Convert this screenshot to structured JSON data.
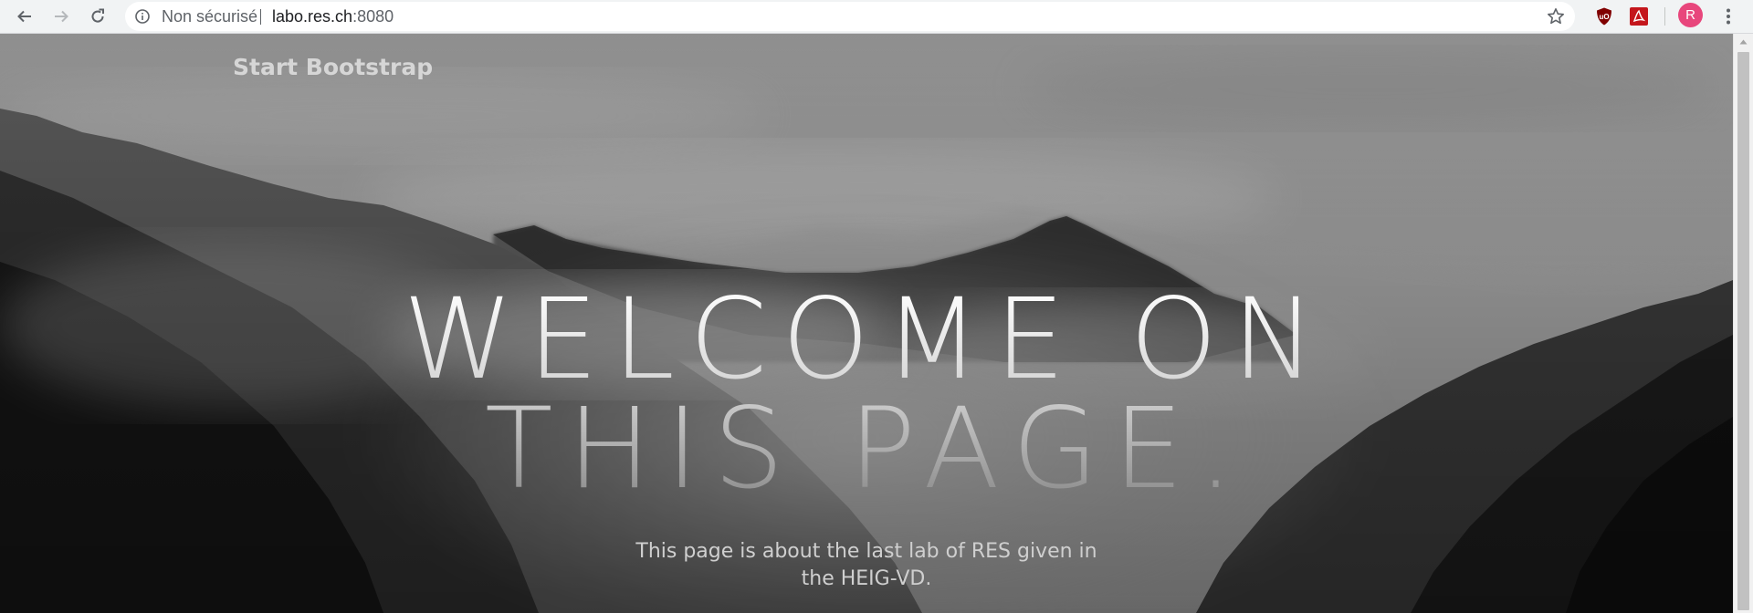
{
  "browser": {
    "omnibox": {
      "security_label": "Non sécurisé",
      "url_host": "labo.res.ch",
      "url_port": ":8080"
    },
    "avatar_initial": "R",
    "icons": {
      "back": "arrow-left-icon",
      "forward": "arrow-right-icon",
      "reload": "reload-icon",
      "info": "info-circle-icon",
      "bookmark": "star-outline-icon",
      "ublock": "ublock-origin-icon",
      "pdf": "acrobat-pdf-icon",
      "menu": "three-dots-vertical-icon"
    },
    "colors": {
      "toolbar_bg": "#f1f3f4",
      "avatar_bg": "#e8467c",
      "ublock": "#800000",
      "pdf": "#c4161c"
    }
  },
  "page": {
    "navbar": {
      "brand": "Start Bootstrap"
    },
    "hero": {
      "line_1": "WELCOME ON",
      "line_2": "THIS PAGE."
    },
    "subtitle_line_1": "This page is about the last lab of RES given in",
    "subtitle_line_2": "the HEIG-VD."
  }
}
